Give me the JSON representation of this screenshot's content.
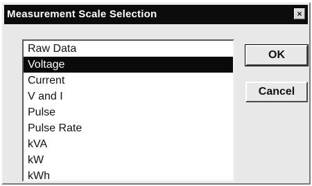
{
  "dialog": {
    "title": "Measurement Scale Selection",
    "close_label": "×"
  },
  "list": {
    "selected": "Voltage",
    "items": [
      "Raw Data",
      "Voltage",
      "Current",
      "V and I",
      "Pulse",
      "Pulse Rate",
      "kVA",
      "kW",
      "kWh"
    ]
  },
  "buttons": {
    "ok": "OK",
    "cancel": "Cancel"
  },
  "colors": {
    "titlebar": "#0c0c0c",
    "selection": "#0a0a0a",
    "face": "#e8e8e8"
  }
}
